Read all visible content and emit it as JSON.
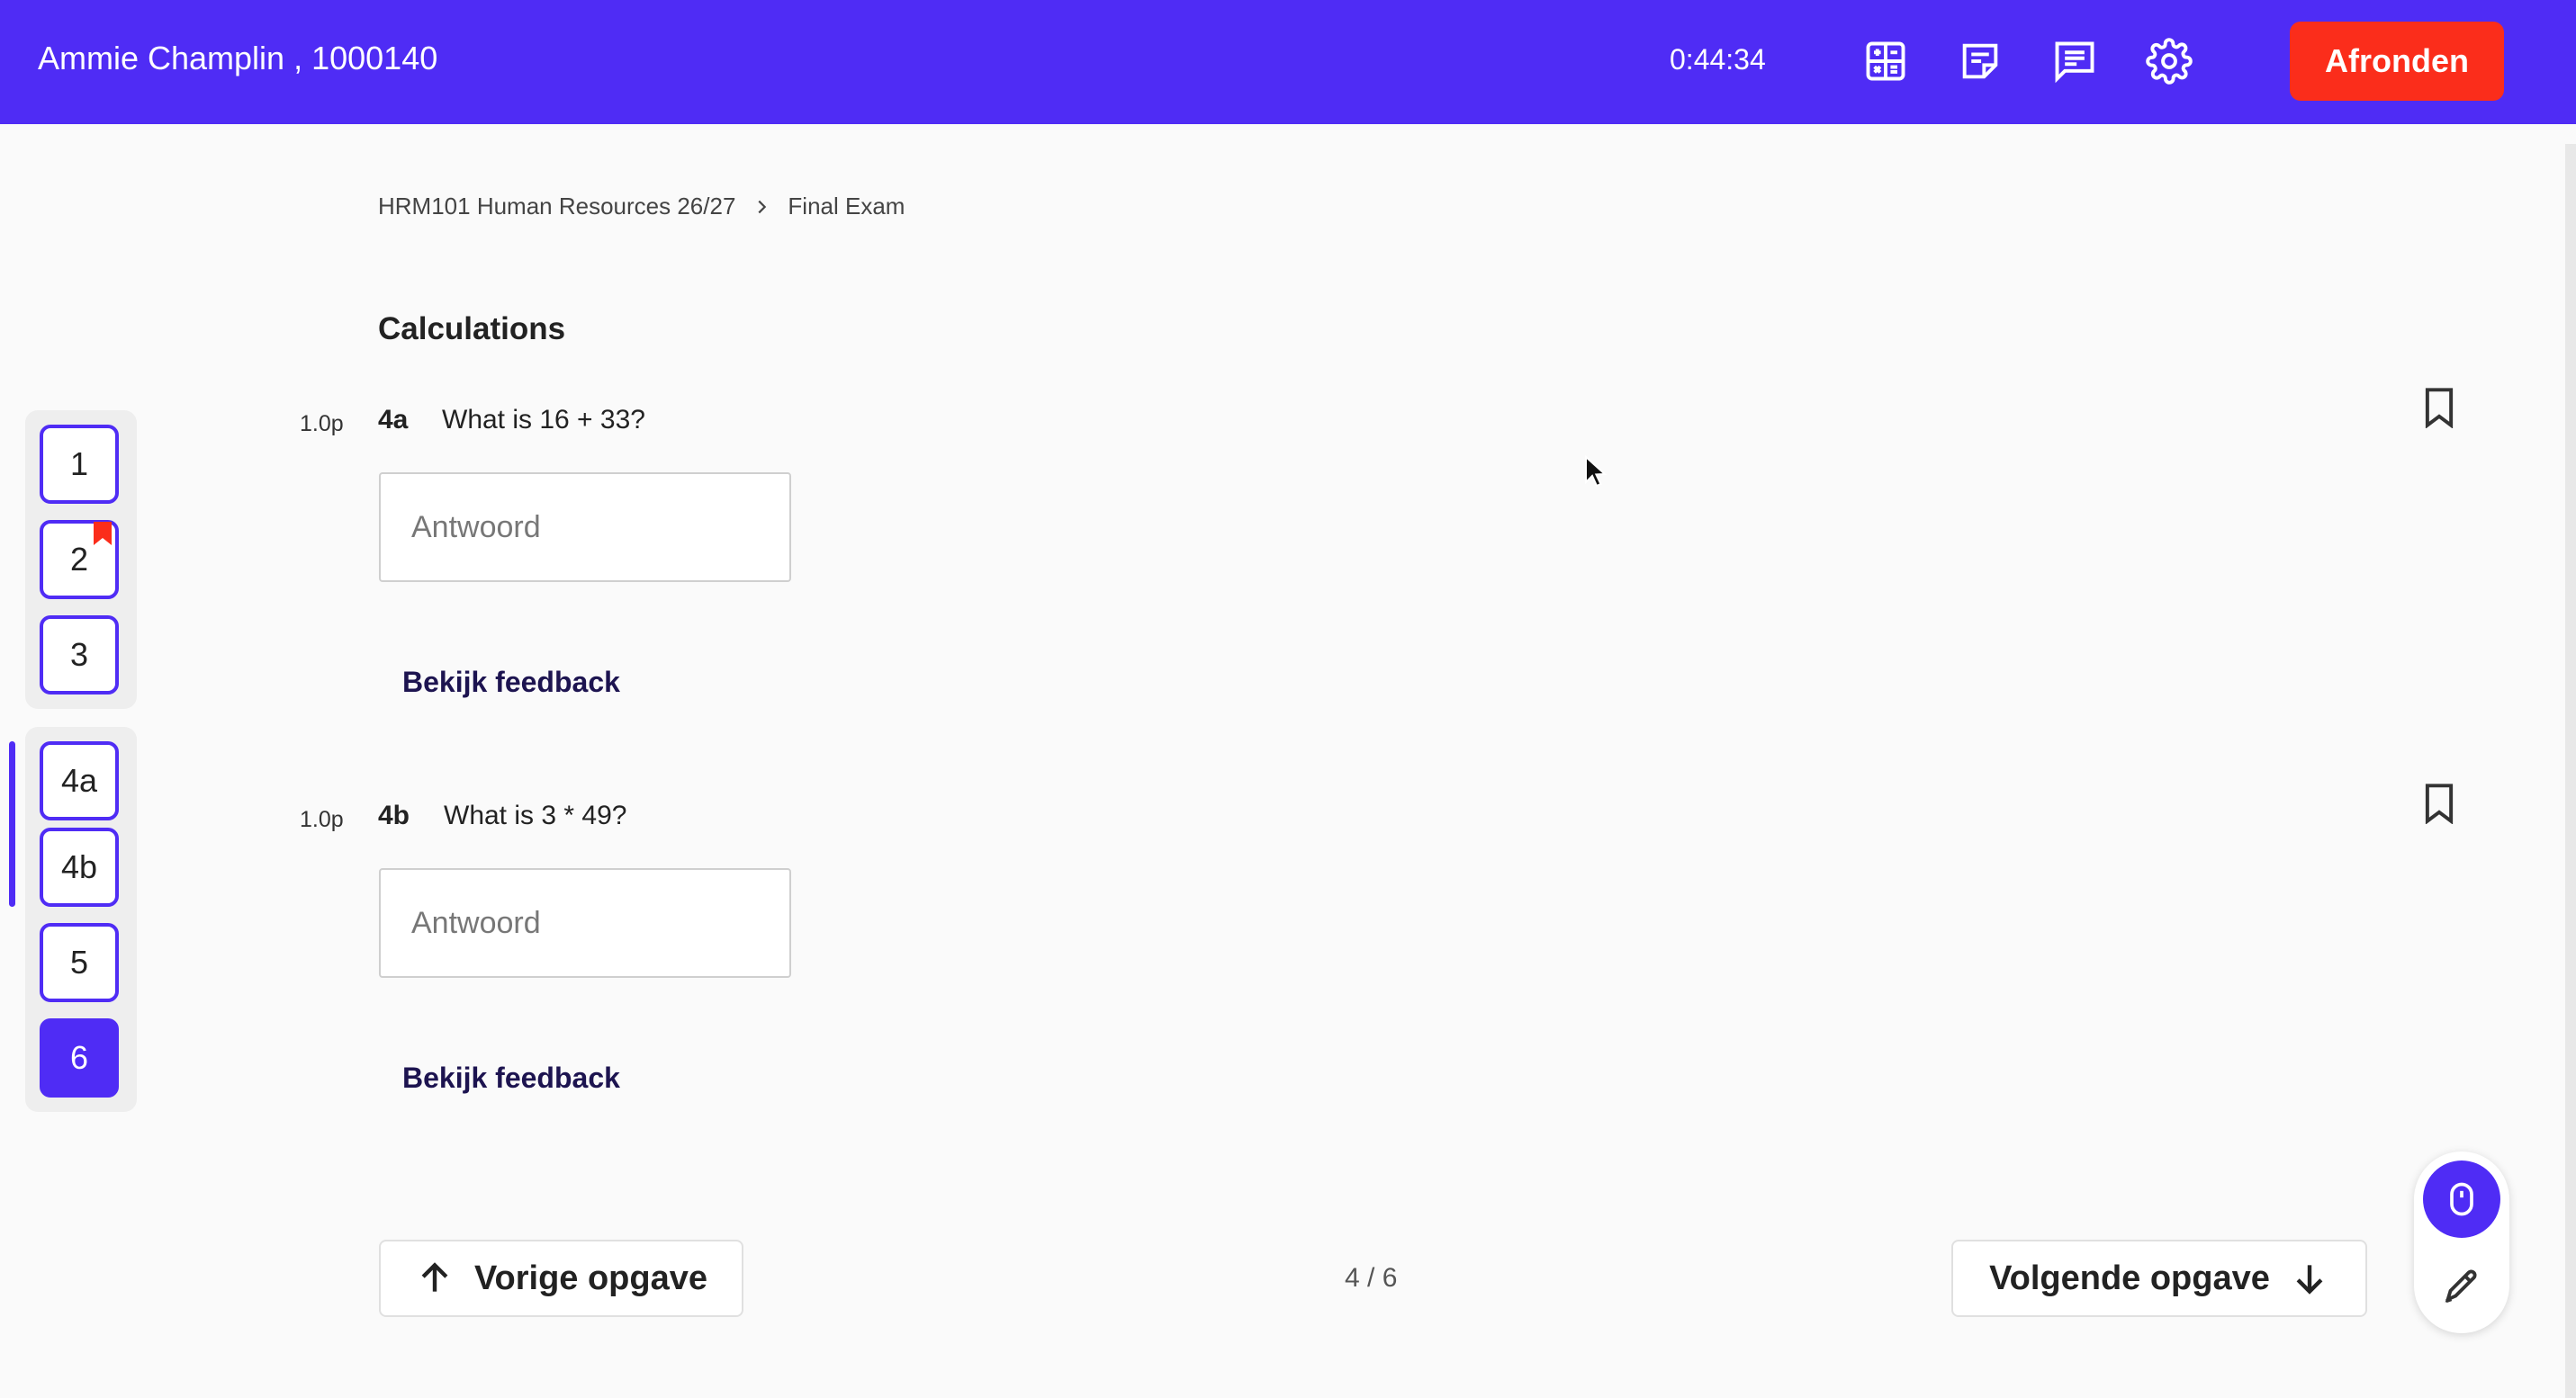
{
  "header": {
    "student_name": "Ammie Champlin , 1000140",
    "timer": "0:44:34",
    "tools": [
      "calculator-icon",
      "notes-icon",
      "chat-icon",
      "settings-icon"
    ],
    "finish_label": "Afronden"
  },
  "breadcrumb": {
    "course": "HRM101 Human Resources 26/27",
    "exam": "Final Exam"
  },
  "section_title": "Calculations",
  "questions": [
    {
      "points": "1.0p",
      "label": "4a",
      "text": "What is 16 + 33?",
      "answer_value": "",
      "answer_placeholder": "Antwoord",
      "feedback_label": "Bekijk feedback"
    },
    {
      "points": "1.0p",
      "label": "4b",
      "text": "What is 3 * 49?",
      "answer_value": "",
      "answer_placeholder": "Antwoord",
      "feedback_label": "Bekijk feedback"
    }
  ],
  "question_nav": {
    "items": [
      {
        "label": "1",
        "flagged": false,
        "answered": false
      },
      {
        "label": "2",
        "flagged": true,
        "answered": false
      },
      {
        "label": "3",
        "flagged": false,
        "answered": false
      },
      {
        "label": "4a",
        "flagged": false,
        "answered": false
      },
      {
        "label": "4b",
        "flagged": false,
        "answered": false
      },
      {
        "label": "5",
        "flagged": false,
        "answered": false
      },
      {
        "label": "6",
        "flagged": false,
        "answered": true
      }
    ]
  },
  "footer": {
    "prev_label": "Vorige opgave",
    "next_label": "Volgende opgave",
    "page_indicator": "4 / 6"
  },
  "colors": {
    "primary": "#4f2cf5",
    "finish": "#fb2d1b",
    "flag": "#fb2d1b",
    "background": "#fafafa"
  },
  "tool_palette": {
    "items": [
      "mouse-icon",
      "pen-icon"
    ],
    "active": "mouse-icon"
  }
}
